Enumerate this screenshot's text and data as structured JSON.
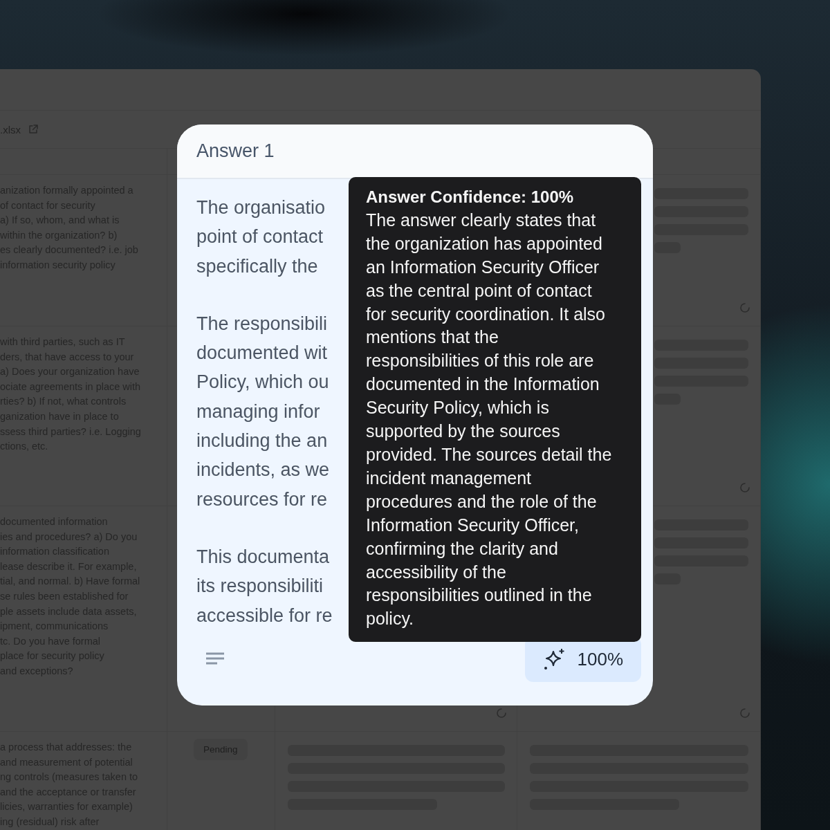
{
  "sheet": {
    "file_name": ".xlsx"
  },
  "rows": [
    {
      "question_lines": [
        "anization formally appointed a",
        "of contact for security",
        "a) If so, whom, and what is",
        "within the organization? b)",
        "es clearly documented? i.e. job",
        "information security policy"
      ],
      "review": {
        "loading": true,
        "spinner": true
      }
    },
    {
      "question_lines": [
        "with third parties, such as IT",
        "ders, that have access to your",
        "a) Does your organization have",
        "ociate agreements in place with",
        "rties? b) If not, what controls",
        "ganization have in place to",
        "ssess third parties? i.e. Logging",
        "ctions, etc."
      ],
      "review": {
        "loading": true,
        "spinner": true
      }
    },
    {
      "question_lines": [
        "documented information",
        "ies and procedures? a) Do you",
        "information classification",
        "lease describe it. For example,",
        "tial, and normal. b) Have formal",
        "se rules been established for",
        "ple assets include data assets,",
        "ipment, communications",
        "tc. Do you have formal",
        "place for security policy",
        "and exceptions?"
      ],
      "answer": {
        "spinner": true
      },
      "review": {
        "loading": true,
        "spinner": true
      }
    },
    {
      "question_lines": [
        "a process that addresses: the",
        "and measurement of potential",
        "ng controls (measures taken to",
        "and the acceptance or transfer",
        "licies, warranties for example)",
        "ing (residual) risk after"
      ],
      "status": "Pending",
      "answer": {
        "loading": true,
        "spinner": false
      },
      "review": {
        "loading": true,
        "spinner": false
      }
    }
  ],
  "modal": {
    "title": "Answer 1",
    "paragraphs": [
      [
        "The organisatio",
        "point of contact",
        "specifically the"
      ],
      [
        "The responsibili",
        "documented wit",
        "Policy, which ou",
        "managing infor",
        "including the an",
        "incidents, as we",
        "resources for re"
      ],
      [
        "This documenta",
        "its responsibiliti",
        "accessible for re"
      ]
    ],
    "tooltip": {
      "title": "Answer Confidence: 100%",
      "text": "The answer clearly states that the organization has appointed an Information Security Officer as the central point of contact for security coordination. It also mentions that the responsibilities of this role are documented in the Information Security Policy, which is supported by the sources provided. The sources detail the incident management procedures and the role of the Information Security Officer, confirming the clarity and accessibility of the responsibilities outlined in the policy."
    },
    "confidence": "100%"
  }
}
